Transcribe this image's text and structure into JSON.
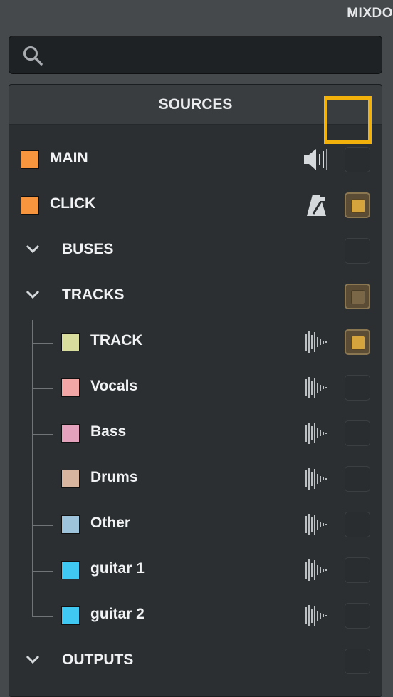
{
  "window": {
    "title": "MIXDO"
  },
  "search": {
    "placeholder": "",
    "value": ""
  },
  "panel": {
    "title": "SOURCES"
  },
  "colors": {
    "accent": "#f2b20b",
    "checkbox_on": "#d6a43c"
  },
  "sources": [
    {
      "label": "MAIN",
      "swatch": "#f7943e",
      "icon": "speaker-icon",
      "checked": false
    },
    {
      "label": "CLICK",
      "swatch": "#f7943e",
      "icon": "metronome-icon",
      "checked": true,
      "focused": true
    }
  ],
  "groups": {
    "buses": {
      "label": "BUSES",
      "checked": false
    },
    "tracks": {
      "label": "TRACKS",
      "checked": "partial"
    },
    "outputs": {
      "label": "OUTPUTS",
      "checked": false
    }
  },
  "tracks": [
    {
      "label": "TRACK",
      "swatch": "#d8dc9c",
      "icon": "waveform-icon",
      "checked": true
    },
    {
      "label": "Vocals",
      "swatch": "#f2a6a6",
      "icon": "waveform-icon",
      "checked": false
    },
    {
      "label": "Bass",
      "swatch": "#e5a2bd",
      "icon": "waveform-icon",
      "checked": false
    },
    {
      "label": "Drums",
      "swatch": "#d8b59e",
      "icon": "waveform-icon",
      "checked": false
    },
    {
      "label": "Other",
      "swatch": "#9ec4dc",
      "icon": "waveform-icon",
      "checked": false
    },
    {
      "label": "guitar 1",
      "swatch": "#40c7f2",
      "icon": "waveform-icon",
      "checked": false
    },
    {
      "label": "guitar 2",
      "swatch": "#40c7f2",
      "icon": "waveform-icon",
      "checked": false
    }
  ]
}
